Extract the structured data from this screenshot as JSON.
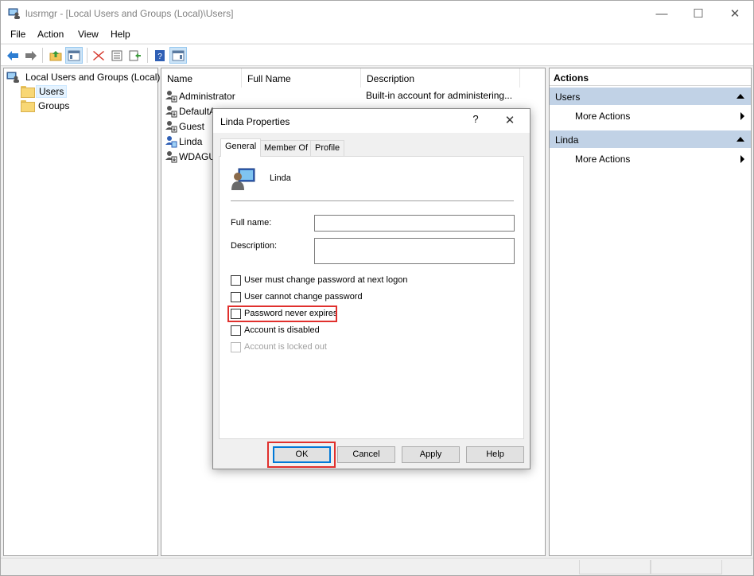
{
  "window": {
    "title": "lusrmgr - [Local Users and Groups (Local)\\Users]"
  },
  "controls": {
    "minimize": "—",
    "maximize": "☐",
    "close": "✕"
  },
  "menu": [
    "File",
    "Action",
    "View",
    "Help"
  ],
  "tree": {
    "root": "Local Users and Groups (Local)",
    "items": [
      {
        "label": "Users",
        "selected": true
      },
      {
        "label": "Groups"
      }
    ]
  },
  "list": {
    "columns": [
      "Name",
      "Full Name",
      "Description"
    ],
    "rows": [
      {
        "name": "Administrator",
        "full_name": "",
        "description": "Built-in account for administering..."
      },
      {
        "name": "DefaultA",
        "full_name": "",
        "description": ""
      },
      {
        "name": "Guest",
        "full_name": "",
        "description": ""
      },
      {
        "name": "Linda",
        "full_name": "",
        "description": ""
      },
      {
        "name": "WDAGU",
        "full_name": "",
        "description": ""
      }
    ]
  },
  "actions": {
    "header": "Actions",
    "groups": [
      {
        "title": "Users",
        "items": [
          "More Actions"
        ]
      },
      {
        "title": "Linda",
        "items": [
          "More Actions"
        ]
      }
    ]
  },
  "dialog": {
    "title": "Linda Properties",
    "help": "?",
    "close": "✕",
    "tabs": [
      "General",
      "Member Of",
      "Profile"
    ],
    "user_name": "Linda",
    "full_name_label": "Full name:",
    "full_name_value": "",
    "description_label": "Description:",
    "description_value": "",
    "checkboxes": [
      {
        "label": "User must change password at next logon",
        "checked": false,
        "enabled": true
      },
      {
        "label": "User cannot change password",
        "checked": false,
        "enabled": true
      },
      {
        "label": "Password never expires",
        "checked": false,
        "enabled": true,
        "highlighted": true
      },
      {
        "label": "Account is disabled",
        "checked": false,
        "enabled": true
      },
      {
        "label": "Account is locked out",
        "checked": false,
        "enabled": false
      }
    ],
    "buttons": {
      "ok": "OK",
      "cancel": "Cancel",
      "apply": "Apply",
      "help": "Help"
    }
  },
  "colors": {
    "highlight": "#e0302d",
    "action_group": "#c1d2e6",
    "accent": "#0078d7"
  }
}
